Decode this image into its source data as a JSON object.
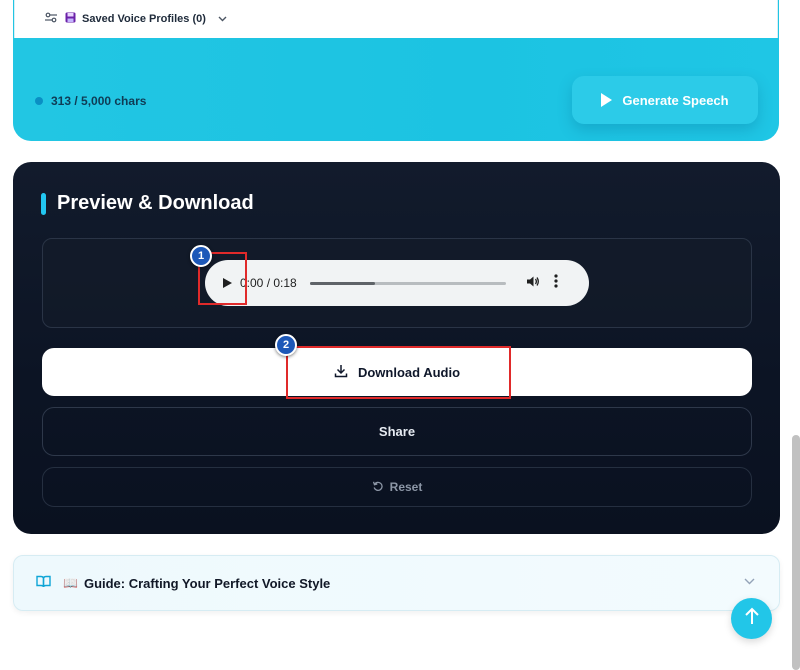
{
  "generator": {
    "profiles_label": "Saved Voice Profiles (0)",
    "char_count": "313 / 5,000 chars",
    "generate_label": "Generate Speech"
  },
  "preview": {
    "title": "Preview & Download",
    "player": {
      "time": "0:00 / 0:18",
      "progress_fraction": 0.33
    },
    "download_label": "Download Audio",
    "share_label": "Share",
    "reset_label": "Reset"
  },
  "annotations": {
    "badge_1": "1",
    "badge_2": "2",
    "color": "#e02a2a"
  },
  "guide": {
    "emoji": "📖",
    "title": "Guide: Crafting Your Perfect Voice Style"
  },
  "colors": {
    "accent": "#22c6e3",
    "dark_card": "#0c1424",
    "badge": "#1d58b8"
  },
  "icons": {
    "profiles": "sliders-icon",
    "disk": "floppy-disk-icon",
    "play": "play-icon",
    "download": "download-icon",
    "reset": "rotate-ccw-icon",
    "book": "book-open-icon",
    "scroll_top": "arrow-up-icon"
  }
}
